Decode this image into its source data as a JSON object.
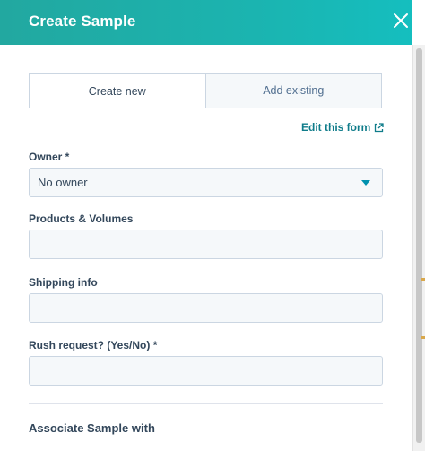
{
  "header": {
    "title": "Create Sample",
    "close_icon": "close-icon"
  },
  "tabs": [
    {
      "label": "Create new",
      "active": true
    },
    {
      "label": "Add existing",
      "active": false
    }
  ],
  "edit_link": {
    "label": "Edit this form",
    "icon": "external-link-icon"
  },
  "fields": {
    "owner": {
      "label": "Owner *",
      "value": "No owner"
    },
    "products": {
      "label": "Products & Volumes",
      "value": ""
    },
    "shipping": {
      "label": "Shipping info",
      "value": ""
    },
    "rush": {
      "label": "Rush request? (Yes/No) *",
      "value": ""
    }
  },
  "associate": {
    "title": "Associate Sample with"
  },
  "colors": {
    "header": "#1bb4b0",
    "link": "#0f7c8a",
    "text": "#33475b",
    "input_bg": "#f5f8fa",
    "border": "#cbd6e2"
  }
}
